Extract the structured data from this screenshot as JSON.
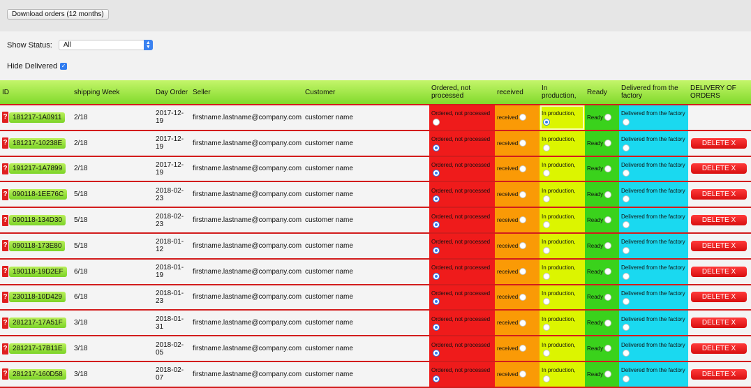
{
  "toolbar": {
    "download_label": "Download orders (12 months)"
  },
  "filters": {
    "status_label": "Show Status:",
    "status_value": "All",
    "hide_delivered_label": "Hide Delivered",
    "hide_delivered_checked": true
  },
  "colors": {
    "ordered": "#ef1b1b",
    "received": "#fa9a06",
    "production": "#dcf500",
    "ready": "#3ad21c",
    "delivered": "#1ad9f0",
    "header": "#9be23e",
    "delete": "#e01515"
  },
  "table": {
    "headers": [
      "ID",
      "shipping Week",
      "Day Order",
      "Seller",
      "Customer",
      "Ordered, not processed",
      "received",
      "In production,",
      "Ready",
      "Delivered from the factory",
      "DELIVERY OF ORDERS"
    ],
    "status_labels": {
      "ordered": "Ordered, not processed",
      "received": "received",
      "production": "In production,",
      "ready": "Ready",
      "delivered": "Delivered from the factory"
    },
    "delete_label": "DELETE X",
    "rows": [
      {
        "id": "181217-1A0911",
        "week": "2/18",
        "day": "2017-12-19",
        "seller": "firstname.lastname@company.com",
        "customer": "customer name",
        "status": "production",
        "has_delete": false
      },
      {
        "id": "181217-10238E",
        "week": "2/18",
        "day": "2017-12-19",
        "seller": "firstname.lastname@company.com",
        "customer": "customer name",
        "status": "ordered",
        "has_delete": true
      },
      {
        "id": "191217-1A7899",
        "week": "2/18",
        "day": "2017-12-19",
        "seller": "firstname.lastname@company.com",
        "customer": "customer name",
        "status": "ordered",
        "has_delete": true
      },
      {
        "id": "090118-1EE76C",
        "week": "5/18",
        "day": "2018-02-23",
        "seller": "firstname.lastname@company.com",
        "customer": "customer name",
        "status": "ordered",
        "has_delete": true
      },
      {
        "id": "090118-134D30",
        "week": "5/18",
        "day": "2018-02-23",
        "seller": "firstname.lastname@company.com",
        "customer": "customer name",
        "status": "ordered",
        "has_delete": true
      },
      {
        "id": "090118-173E80",
        "week": "5/18",
        "day": "2018-01-12",
        "seller": "firstname.lastname@company.com",
        "customer": "customer name",
        "status": "ordered",
        "has_delete": true
      },
      {
        "id": "190118-19D2EF",
        "week": "6/18",
        "day": "2018-01-19",
        "seller": "firstname.lastname@company.com",
        "customer": "customer name",
        "status": "ordered",
        "has_delete": true
      },
      {
        "id": "230118-10D429",
        "week": "6/18",
        "day": "2018-01-23",
        "seller": "firstname.lastname@company.com",
        "customer": "customer name",
        "status": "ordered",
        "has_delete": true
      },
      {
        "id": "281217-17A51F",
        "week": "3/18",
        "day": "2018-01-31",
        "seller": "firstname.lastname@company.com",
        "customer": "customer name",
        "status": "ordered",
        "has_delete": true
      },
      {
        "id": "281217-17B11E",
        "week": "3/18",
        "day": "2018-02-05",
        "seller": "firstname.lastname@company.com",
        "customer": "customer name",
        "status": "ordered",
        "has_delete": true
      },
      {
        "id": "281217-160D58",
        "week": "3/18",
        "day": "2018-02-07",
        "seller": "firstname.lastname@company.com",
        "customer": "customer name",
        "status": "ordered",
        "has_delete": true
      }
    ]
  }
}
